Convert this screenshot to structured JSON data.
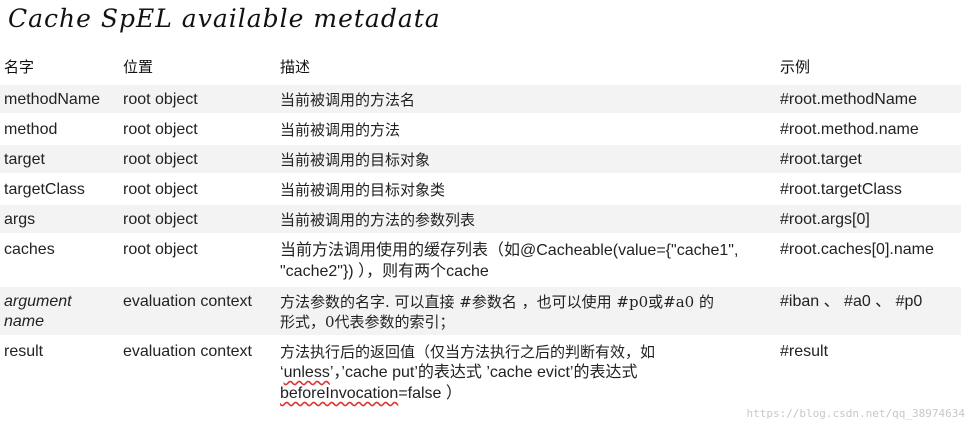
{
  "title": "Cache SpEL available metadata",
  "headers": [
    "名字",
    "位置",
    "描述",
    "示例"
  ],
  "rows": [
    {
      "name": "methodName",
      "location": "root object",
      "description": "当前被调用的方法名",
      "example": "#root.methodName"
    },
    {
      "name": "method",
      "location": "root object",
      "description": "当前被调用的方法",
      "example": "#root.method.name"
    },
    {
      "name": "target",
      "location": "root object",
      "description": "当前被调用的目标对象",
      "example": "#root.target"
    },
    {
      "name": "targetClass",
      "location": "root object",
      "description": "当前被调用的目标对象类",
      "example": "#root.targetClass"
    },
    {
      "name": "args",
      "location": "root object",
      "description": "当前被调用的方法的参数列表",
      "example": "#root.args[0]"
    },
    {
      "name": "caches",
      "location": "root object",
      "description_line1": "当前方法调用使用的缓存列表（如@Cacheable(value={\"cache1\",",
      "description_line2": "\"cache2\"}) ），则有两个cache",
      "example": "#root.caches[0].name"
    },
    {
      "name": "argument name",
      "location": "evaluation context",
      "description_line1": "方法参数的名字. 可以直接 #参数名 ，也可以使用 #p0或#a0 的",
      "description_line2": "形式，0代表参数的索引；",
      "example": "#iban 、 #a0 、  #p0"
    },
    {
      "name": "result",
      "location": "evaluation context",
      "description_line1": "方法执行后的返回值（仅当方法执行之后的判断有效，如",
      "description_line2_pre": "‘",
      "description_line2_unless": "unless",
      "description_line2_sep": "’，’",
      "description_line2_rest": "cache put’的表达式 ’cache evict’的表达式",
      "description_line3_before": "beforeInvocation",
      "description_line3_rest": "=false ）",
      "example": "#result"
    }
  ],
  "watermark": "https://blog.csdn.net/qq_38974634"
}
